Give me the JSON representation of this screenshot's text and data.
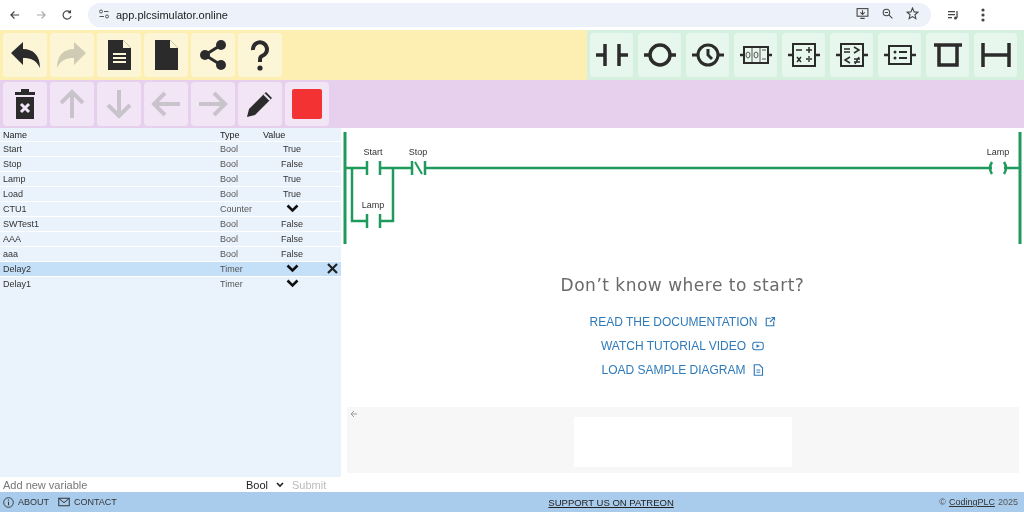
{
  "browser": {
    "url": "app.plcsimulator.online",
    "nav": [
      {
        "kind": "back",
        "disabled": false
      },
      {
        "kind": "forward",
        "disabled": true
      },
      {
        "kind": "reload",
        "disabled": false
      }
    ]
  },
  "edit_toolbar": [
    {
      "kind": "undo",
      "disabled": false
    },
    {
      "kind": "redo",
      "disabled": true
    },
    {
      "kind": "document",
      "disabled": false
    },
    {
      "kind": "blank",
      "disabled": false
    },
    {
      "kind": "share",
      "disabled": false
    },
    {
      "kind": "help",
      "disabled": false
    }
  ],
  "instruction_toolbar": [
    {
      "kind": "contact"
    },
    {
      "kind": "coil"
    },
    {
      "kind": "timer"
    },
    {
      "kind": "counter"
    },
    {
      "kind": "math"
    },
    {
      "kind": "compare"
    },
    {
      "kind": "assign"
    },
    {
      "kind": "branch_open"
    },
    {
      "kind": "branch_close"
    }
  ],
  "element_toolbar": [
    {
      "kind": "delete",
      "disabled": false
    },
    {
      "kind": "up",
      "disabled": true
    },
    {
      "kind": "down",
      "disabled": true
    },
    {
      "kind": "left",
      "disabled": true
    },
    {
      "kind": "right",
      "disabled": true
    },
    {
      "kind": "edit",
      "disabled": false
    },
    {
      "kind": "stop",
      "disabled": false
    }
  ],
  "variables": {
    "columns": [
      "Name",
      "Type",
      "Value"
    ],
    "rows": [
      {
        "name": "Start",
        "type": "Bool",
        "kind": "bool",
        "value": "True",
        "selected": false
      },
      {
        "name": "Stop",
        "type": "Bool",
        "kind": "bool",
        "value": "False",
        "selected": false
      },
      {
        "name": "Lamp",
        "type": "Bool",
        "kind": "bool",
        "value": "True",
        "selected": false
      },
      {
        "name": "Load",
        "type": "Bool",
        "kind": "bool",
        "value": "True",
        "selected": false
      },
      {
        "name": "CTU1",
        "type": "Counter",
        "kind": "expand",
        "selected": false
      },
      {
        "name": "SWTest1",
        "type": "Bool",
        "kind": "bool",
        "value": "False",
        "selected": false
      },
      {
        "name": "AAA",
        "type": "Bool",
        "kind": "bool",
        "value": "False",
        "selected": false
      },
      {
        "name": "aaa",
        "type": "Bool",
        "kind": "bool",
        "value": "False",
        "selected": false
      },
      {
        "name": "Delay2",
        "type": "Timer",
        "kind": "expand",
        "selected": true
      },
      {
        "name": "Delay1",
        "type": "Timer",
        "kind": "expand",
        "selected": false
      }
    ],
    "add": {
      "placeholder": "Add new variable",
      "type": "Bool",
      "submit": "Submit"
    }
  },
  "diagram": {
    "elements": [
      {
        "kind": "contact_no",
        "label": "Start"
      },
      {
        "kind": "contact_nc",
        "label": "Stop"
      },
      {
        "kind": "coil",
        "label": "Lamp"
      },
      {
        "kind": "branch_contact_no",
        "label": "Lamp"
      }
    ]
  },
  "help": {
    "heading": "Don’t know where to start?",
    "links": [
      {
        "text": "READ THE DOCUMENTATION",
        "kind": "external"
      },
      {
        "text": "WATCH TUTORIAL VIDEO",
        "kind": "video"
      },
      {
        "text": "LOAD SAMPLE DIAGRAM",
        "kind": "file"
      }
    ]
  },
  "footer": {
    "about": "ABOUT",
    "contact": "CONTACT",
    "patreon": "SUPPORT US ON PATREON",
    "copyright": "©",
    "owner": "CodingPLC",
    "year": "2025"
  }
}
